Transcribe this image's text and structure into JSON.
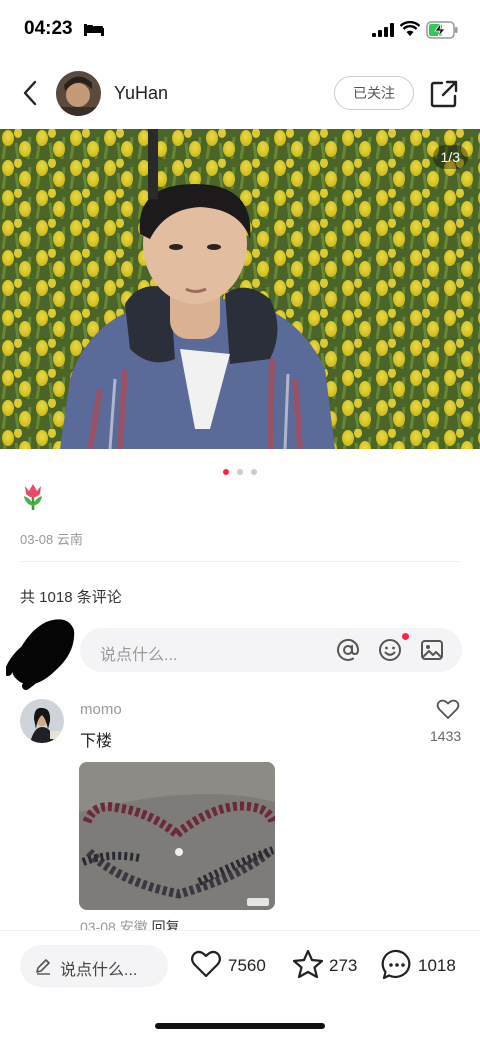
{
  "status_bar": {
    "time": "04:23"
  },
  "header": {
    "username": "YuHan",
    "follow_label": "已关注"
  },
  "photo": {
    "counter": "1/3",
    "page_current": 1,
    "page_total": 3
  },
  "post": {
    "emoji": "🌷",
    "date": "03-08",
    "location": "云南"
  },
  "comments": {
    "count_label": "共 1018 条评论",
    "input_placeholder": "说点什么...",
    "items": [
      {
        "user": "momo",
        "text": "下楼",
        "likes": "1433",
        "date": "03-08",
        "location": "安徽",
        "reply_label": "回复"
      }
    ]
  },
  "bottom_bar": {
    "input_placeholder": "说点什么...",
    "likes": "7560",
    "stars": "273",
    "comments": "1018"
  },
  "colors": {
    "accent": "#ff2442",
    "muted": "#999999"
  }
}
